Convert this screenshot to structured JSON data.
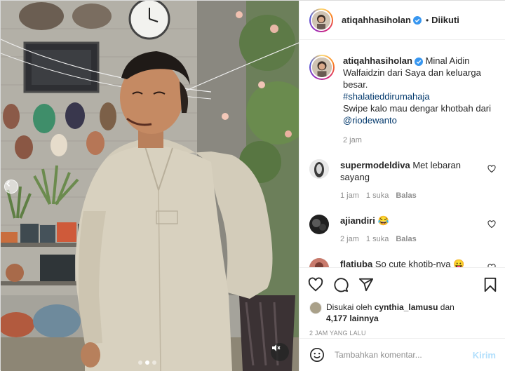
{
  "post": {
    "username": "atiqahhasiholan",
    "verified": true,
    "follow_state": "Diikuti",
    "separator": "•"
  },
  "caption": {
    "username": "atiqahhasiholan",
    "text_1": "Minal Aidin Walfaidzin dari Saya dan keluarga besar.",
    "hashtag": "#shalatieddirumahaja",
    "text_2": "Swipe kalo mau dengar khotbah dari",
    "mention": "@riodewanto",
    "time": "2 jam"
  },
  "comments": [
    {
      "username": "supermodeldiva",
      "text": "Met lebaran sayang",
      "time": "1 jam",
      "likes": "1 suka",
      "reply": "Balas"
    },
    {
      "username": "ajiandiri",
      "text": "😂",
      "time": "2 jam",
      "likes": "1 suka",
      "reply": "Balas"
    },
    {
      "username": "flatjuba",
      "text": "So cute khotib-nya 😛",
      "time": "",
      "likes": "",
      "reply": ""
    }
  ],
  "likes": {
    "prefix": "Disukai oleh",
    "user": "cynthia_lamusu",
    "conj": "dan",
    "count": "4,177 lainnya"
  },
  "timestamp": "2 JAM YANG LALU",
  "comment_input": {
    "placeholder": "Tambahkan komentar...",
    "post_label": "Kirim"
  },
  "icons": {
    "like": "heart-icon",
    "comment": "comment-icon",
    "share": "share-icon",
    "save": "bookmark-icon",
    "emoji": "emoji-icon",
    "mute": "mute-icon",
    "prev": "chevron-left-icon"
  },
  "colors": {
    "link": "#00376b",
    "verified": "#3897f0",
    "post_button": "#b2dffc",
    "meta": "#8e8e8e"
  }
}
